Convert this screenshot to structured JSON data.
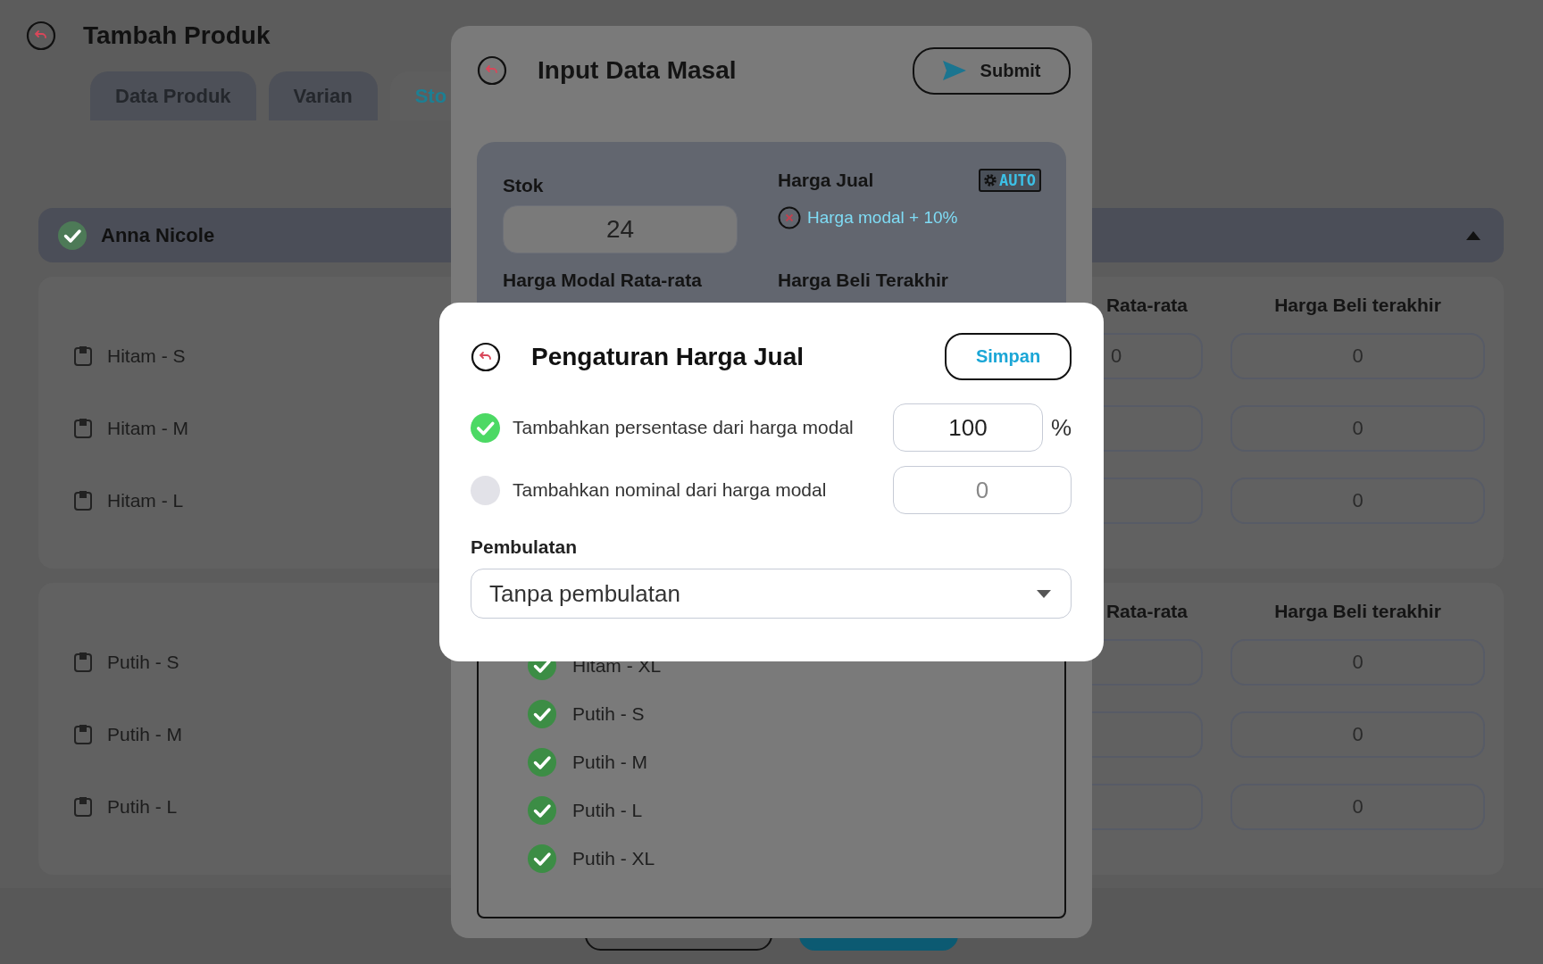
{
  "page": {
    "title": "Tambah Produk",
    "tabs": [
      {
        "label": "Data Produk",
        "selected": false
      },
      {
        "label": "Varian",
        "selected": false
      },
      {
        "label": "Sto",
        "selected": true
      }
    ],
    "group": {
      "name": "Anna Nicole",
      "checked": true,
      "expanded": true
    },
    "cards": [
      {
        "columns": [
          "Rata-rata",
          "Harga Beli terakhir"
        ],
        "rows": [
          {
            "name": "Hitam - S",
            "column_1": "0",
            "column_2": "0"
          },
          {
            "name": "Hitam - M",
            "column_2": "0"
          },
          {
            "name": "Hitam - L",
            "column_2": "0"
          }
        ]
      },
      {
        "columns": [
          "Rata-rata",
          "Harga Beli terakhir"
        ],
        "rows": [
          {
            "name": "Putih - S",
            "column_2": "0"
          },
          {
            "name": "Putih - M",
            "column_2": "0"
          },
          {
            "name": "Putih - L",
            "column_2": "0"
          }
        ]
      }
    ],
    "footer_buttons": [
      {
        "kind": "outline"
      },
      {
        "kind": "primary"
      }
    ]
  },
  "bulk_modal": {
    "title": "Input Data Masal",
    "submit": "Submit",
    "stock_label": "Stok",
    "stock_value": "24",
    "sell_price_label": "Harga Jual",
    "auto_badge": "AUTO",
    "sell_price_rule": "Harga modal + 10%",
    "avg_cost_label": "Harga Modal Rata-rata",
    "last_buy_label": "Harga Beli Terakhir",
    "variants": [
      {
        "name": "Hitam - XL",
        "checked": true
      },
      {
        "name": "Putih - S",
        "checked": true
      },
      {
        "name": "Putih - M",
        "checked": true
      },
      {
        "name": "Putih - L",
        "checked": true
      },
      {
        "name": "Putih - XL",
        "checked": true
      }
    ]
  },
  "price_dialog": {
    "title": "Pengaturan Harga Jual",
    "save": "Simpan",
    "options": [
      {
        "label": "Tambahkan persentase dari harga modal",
        "selected": true,
        "value": "100",
        "unit": "%"
      },
      {
        "label": "Tambahkan nominal dari harga modal",
        "selected": false,
        "value": "0"
      }
    ],
    "rounding_label": "Pembulatan",
    "rounding_value": "Tanpa pembulatan"
  }
}
